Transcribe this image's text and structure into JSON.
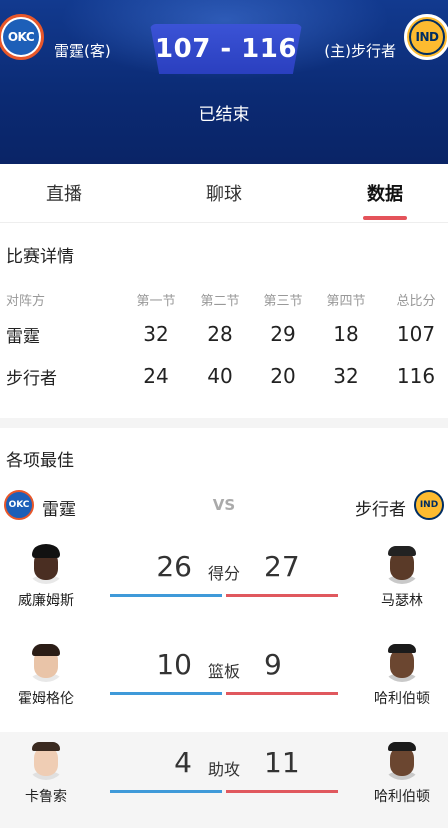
{
  "header": {
    "away_logo": "OKC",
    "away_name": "雷霆(客)",
    "home_logo": "IND",
    "home_name": "(主)步行者",
    "score": "107 - 116",
    "status": "已结束",
    "colors": {
      "bg": "#0b2a73",
      "score_box": "#2a3fbf"
    }
  },
  "tabs": [
    {
      "label": "直播"
    },
    {
      "label": "聊球"
    },
    {
      "label": "数据",
      "active": true
    }
  ],
  "match_details": {
    "title": "比赛详情",
    "headers": [
      "对阵方",
      "第一节",
      "第二节",
      "第三节",
      "第四节",
      "总比分"
    ],
    "rows": [
      {
        "team": "雷霆",
        "q": [
          "32",
          "28",
          "29",
          "18",
          "107"
        ]
      },
      {
        "team": "步行者",
        "q": [
          "24",
          "40",
          "20",
          "32",
          "116"
        ]
      }
    ]
  },
  "best": {
    "title": "各项最佳",
    "left_logo": "OKC",
    "left_team": "雷霆",
    "vs": "VS",
    "right_team": "步行者",
    "right_logo": "IND",
    "accent_left": "#3f9ad9",
    "accent_right": "#e0585e",
    "stats": [
      {
        "label": "得分",
        "left_player": "威廉姆斯",
        "left_value": "26",
        "right_value": "27",
        "right_player": "马瑟林"
      },
      {
        "label": "篮板",
        "left_player": "霍姆格伦",
        "left_value": "10",
        "right_value": "9",
        "right_player": "哈利伯顿"
      },
      {
        "label": "助攻",
        "left_player": "卡鲁索",
        "left_value": "4",
        "right_value": "11",
        "right_player": "哈利伯顿"
      }
    ]
  }
}
